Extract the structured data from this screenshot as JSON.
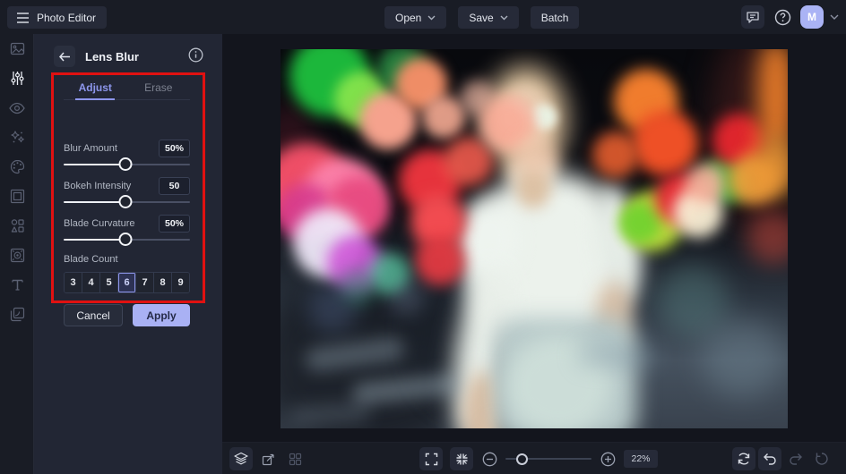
{
  "topbar": {
    "app_label": "Photo Editor",
    "open_label": "Open",
    "save_label": "Save",
    "batch_label": "Batch",
    "avatar_initial": "M",
    "icons": [
      "menu-icon",
      "chevron-down-icon",
      "feedback-chat-icon",
      "help-icon"
    ]
  },
  "sidebar": {
    "icons": [
      "edit-image-icon",
      "adjust-sliders-icon",
      "touch-up-eye-icon",
      "effects-sparkles-icon",
      "artsy-palette-icon",
      "frames-icon",
      "graphics-shapes-icon",
      "textures-icon",
      "text-tool-icon",
      "overlays-icon"
    ],
    "active": "adjust-sliders-icon"
  },
  "panel": {
    "title": "Lens Blur",
    "tabs": {
      "adjust": "Adjust",
      "erase": "Erase"
    },
    "active_tab": "Adjust",
    "sliders": [
      {
        "label": "Blur Amount",
        "value": "50%",
        "percent": 50
      },
      {
        "label": "Bokeh Intensity",
        "value": "50",
        "percent": 50
      },
      {
        "label": "Blade Curvature",
        "value": "50%",
        "percent": 50
      }
    ],
    "blade_count": {
      "label": "Blade Count",
      "options": [
        "3",
        "4",
        "5",
        "6",
        "7",
        "8",
        "9"
      ],
      "selected": "6"
    },
    "cancel_label": "Cancel",
    "apply_label": "Apply",
    "annotation": "red-highlight-rectangle"
  },
  "bottombar": {
    "zoom_value": "22%",
    "icons": [
      "layers-icon",
      "resize-icon",
      "templates-grid-icon",
      "fullscreen-icon",
      "fit-screen-icon",
      "zoom-out-icon",
      "zoom-in-icon",
      "compare-refresh-icon",
      "undo-icon",
      "redo-icon",
      "reset-history-icon"
    ]
  },
  "colors": {
    "accent": "#8d96ec",
    "apply_button": "#a9b1f4",
    "annotation_red": "#e01111",
    "topbar_bg": "#191c25",
    "panel_bg": "#222634",
    "canvas_bg": "#13151d"
  }
}
